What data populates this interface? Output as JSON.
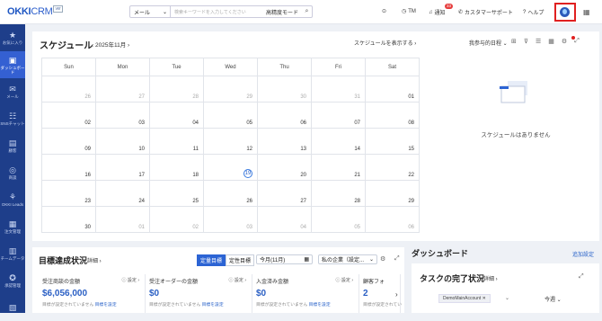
{
  "header": {
    "brand_main": "OKKI",
    "brand_crm": "CRM",
    "brand_version": "ver",
    "search_type": "メール",
    "search_placeholder": "検索キーワードを入力してください",
    "advanced_mode": "高精度モード",
    "tm": "TM",
    "notify": "通知",
    "notify_count": "33",
    "support": "カスタマーサポート",
    "help": "ヘルプ"
  },
  "sidebar": {
    "items": [
      {
        "icon": "star-icon",
        "glyph": "★",
        "label": "お気に入り"
      },
      {
        "icon": "dashboard-icon",
        "glyph": "▣",
        "label": "ダッシュボード"
      },
      {
        "icon": "mail-icon",
        "glyph": "✉",
        "label": "メール"
      },
      {
        "icon": "sns-chat-icon",
        "glyph": "☷",
        "label": "SNSチャット"
      },
      {
        "icon": "customer-icon",
        "glyph": "▤",
        "label": "顧客"
      },
      {
        "icon": "deal-icon",
        "glyph": "◎",
        "label": "商談"
      },
      {
        "icon": "leads-icon",
        "glyph": "⚘",
        "label": "OKKI Leads"
      },
      {
        "icon": "order-icon",
        "glyph": "▦",
        "label": "注文管理"
      },
      {
        "icon": "team-data-icon",
        "glyph": "▥",
        "label": "チームデータ"
      },
      {
        "icon": "promo-icon",
        "glyph": "✪",
        "label": "承認管理"
      },
      {
        "icon": "misc-icon",
        "glyph": "▧",
        "label": ""
      }
    ],
    "active_index": 1
  },
  "schedule": {
    "title": "スケジュール",
    "month": "2025年11月",
    "show_link": "スケジュールを表示する",
    "view_select": "我参与的日程",
    "weekdays": [
      "Sun",
      "Mon",
      "Tue",
      "Wed",
      "Thu",
      "Fri",
      "Sat"
    ],
    "weeks": [
      [
        [
          "26",
          1
        ],
        [
          "27",
          1
        ],
        [
          "28",
          1
        ],
        [
          "29",
          1
        ],
        [
          "30",
          1
        ],
        [
          "31",
          1
        ],
        [
          "01",
          0
        ]
      ],
      [
        [
          "02",
          0
        ],
        [
          "03",
          0
        ],
        [
          "04",
          0
        ],
        [
          "05",
          0
        ],
        [
          "06",
          0
        ],
        [
          "07",
          0
        ],
        [
          "08",
          0
        ]
      ],
      [
        [
          "09",
          0
        ],
        [
          "10",
          0
        ],
        [
          "11",
          0
        ],
        [
          "12",
          0
        ],
        [
          "13",
          0
        ],
        [
          "14",
          0
        ],
        [
          "15",
          0
        ]
      ],
      [
        [
          "16",
          0
        ],
        [
          "17",
          0
        ],
        [
          "18",
          0
        ],
        [
          "19",
          0
        ],
        [
          "20",
          0
        ],
        [
          "21",
          0
        ],
        [
          "22",
          0
        ]
      ],
      [
        [
          "23",
          0
        ],
        [
          "24",
          0
        ],
        [
          "25",
          0
        ],
        [
          "26",
          0
        ],
        [
          "27",
          0
        ],
        [
          "28",
          0
        ],
        [
          "29",
          0
        ]
      ],
      [
        [
          "30",
          0
        ],
        [
          "01",
          1
        ],
        [
          "02",
          1
        ],
        [
          "03",
          1
        ],
        [
          "04",
          1
        ],
        [
          "05",
          1
        ],
        [
          "06",
          1
        ]
      ]
    ],
    "today": "19",
    "empty_text": "スケジュールはありません"
  },
  "goals": {
    "title": "目標達成状況",
    "detail": "詳細",
    "seg_fixed": "定量目標",
    "seg_qual": "定性目標",
    "period": "今月(11月)",
    "company": "私の企業（設定...",
    "cards": [
      {
        "name": "受注商談の金額",
        "value": "$6,056,000",
        "status": "目標が設定されていません",
        "link": "目標を設定",
        "setting": "設定"
      },
      {
        "name": "受注オーダーの金額",
        "value": "$0",
        "status": "目標が設定されていません",
        "link": "目標を設定",
        "setting": "設定"
      },
      {
        "name": "入金済み金額",
        "value": "$0",
        "status": "目標が設定されていません",
        "link": "目標を設定",
        "setting": "設定"
      },
      {
        "name": "顧客フォ",
        "value": "2",
        "status": "目標が設定されてい",
        "link": "",
        "setting": ""
      }
    ]
  },
  "dashboard": {
    "title": "ダッシュボード",
    "add_setting": "追加設定",
    "task_title": "タスクの完了状況",
    "task_detail": "詳細",
    "account_tag": "DemoMainAccount",
    "week": "今週"
  },
  "colors": {
    "sidebar": "#1e3e8a",
    "sidebar_active": "#3460d2",
    "accent": "#2c64d4",
    "highlight": "#e02020"
  }
}
